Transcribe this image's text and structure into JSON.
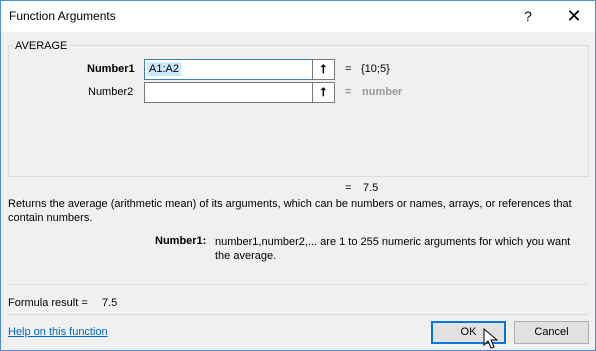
{
  "window": {
    "title": "Function Arguments",
    "help_label": "?",
    "close_label": "✕"
  },
  "function_name": "AVERAGE",
  "args": [
    {
      "label": "Number1",
      "value": "A1:A2",
      "result": "{10;5}"
    },
    {
      "label": "Number2",
      "value": "",
      "result": "number"
    }
  ],
  "equals": "=",
  "preview_result": "7.5",
  "description": "Returns the average (arithmetic mean) of its arguments, which can be numbers or names, arrays, or references that contain numbers.",
  "param_help": {
    "label": "Number1:",
    "text": "number1,number2,... are 1 to 255 numeric arguments for which you want the average."
  },
  "formula_result": {
    "label": "Formula result =",
    "value": "7.5"
  },
  "help_link": "Help on this function",
  "buttons": {
    "ok": "OK",
    "cancel": "Cancel"
  },
  "icons": {
    "ref": "collapse-dialog-icon",
    "ref_glyph": "⭡"
  },
  "colors": {
    "accent": "#0078d7",
    "link": "#0066cc",
    "selection": "#cce8ff"
  }
}
